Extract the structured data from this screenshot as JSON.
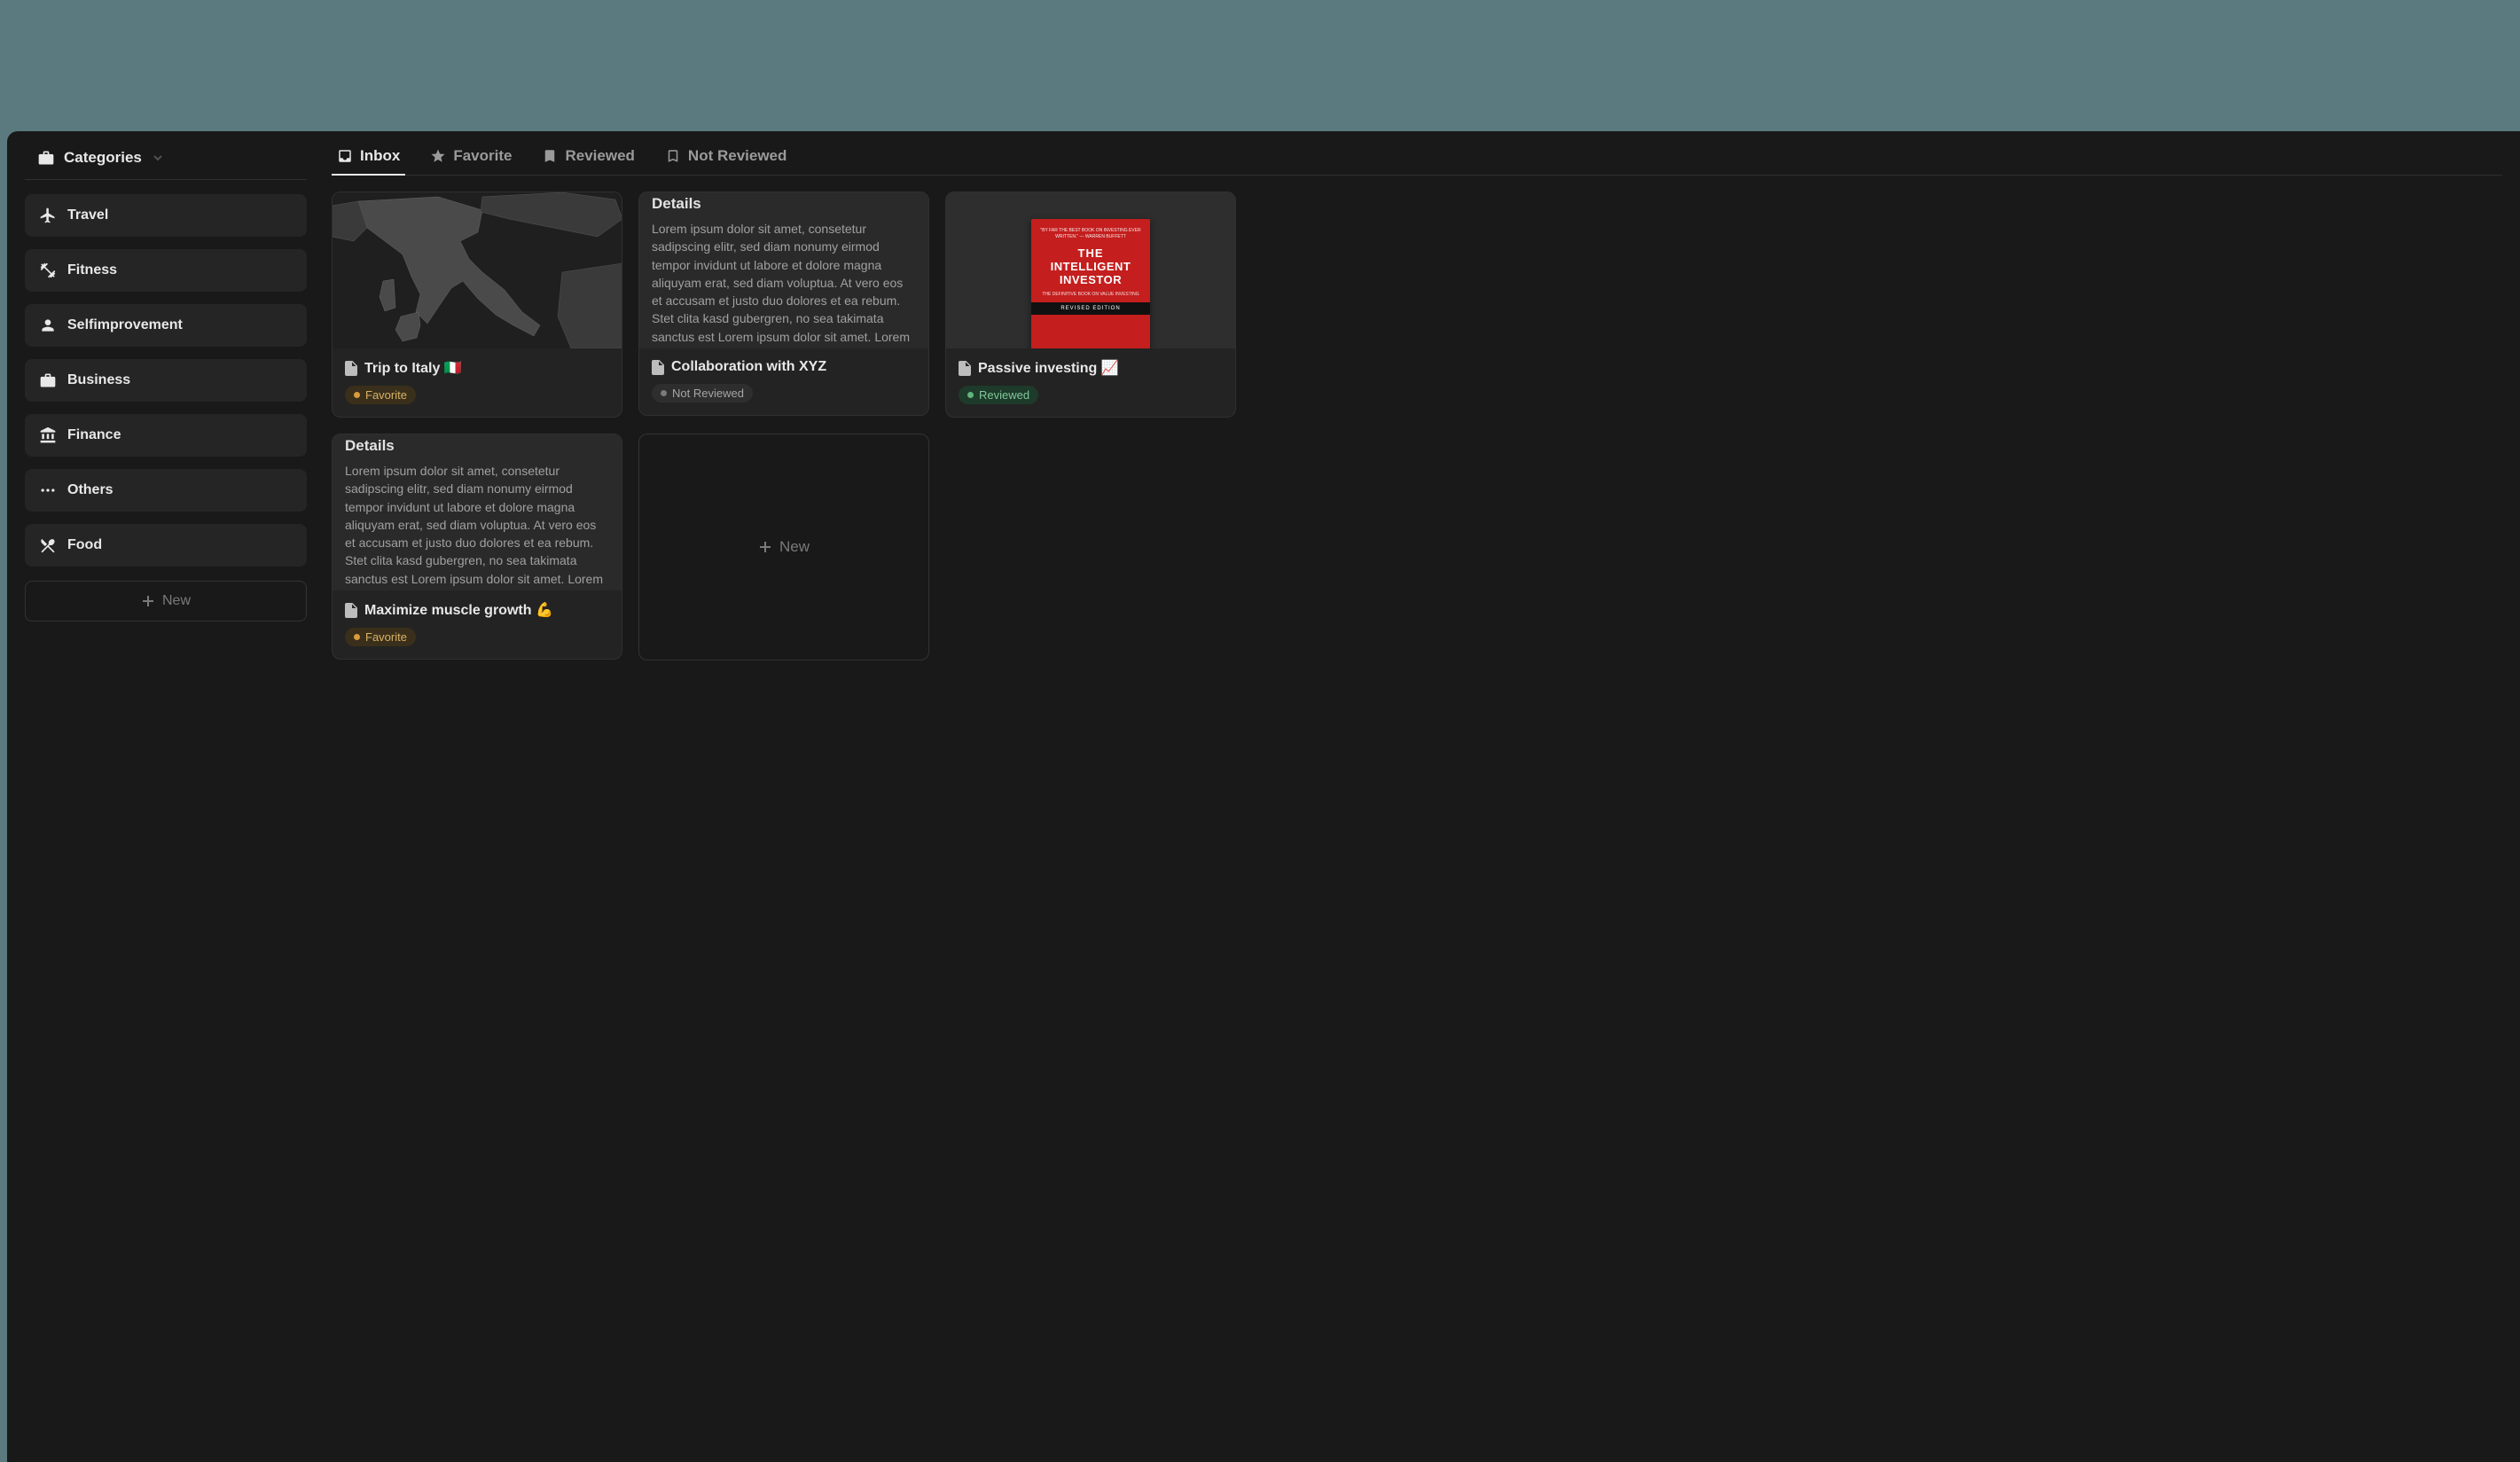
{
  "sidebar": {
    "header": "Categories",
    "items": [
      {
        "label": "Travel"
      },
      {
        "label": "Fitness"
      },
      {
        "label": "Selfimprovement"
      },
      {
        "label": "Business"
      },
      {
        "label": "Finance"
      },
      {
        "label": "Others"
      },
      {
        "label": "Food"
      }
    ],
    "new_label": "New"
  },
  "tabs": [
    {
      "label": "Inbox"
    },
    {
      "label": "Favorite"
    },
    {
      "label": "Reviewed"
    },
    {
      "label": "Not Reviewed"
    }
  ],
  "cards": [
    {
      "title": "Trip to Italy 🇮🇹",
      "badge_label": "Favorite"
    },
    {
      "details_heading": "Details",
      "details_body": "Lorem ipsum dolor sit amet, consetetur sadipscing elitr, sed diam nonumy eirmod tempor invidunt ut labore et dolore magna aliquyam erat, sed diam voluptua. At vero eos et accusam et justo duo dolores et ea rebum. Stet clita kasd gubergren, no sea takimata sanctus est Lorem ipsum dolor sit amet. Lorem",
      "title": "Collaboration with XYZ",
      "badge_label": "Not Reviewed"
    },
    {
      "book_tagline": "\"BY FAR THE BEST BOOK ON INVESTING EVER WRITTEN.\" — WARREN BUFFETT",
      "book_title_the": "THE",
      "book_title_main1": "INTELLIGENT",
      "book_title_main2": "INVESTOR",
      "book_sub": "THE DEFINITIVE BOOK ON VALUE INVESTING",
      "book_bar": "REVISED EDITION",
      "title": "Passive investing 📈",
      "badge_label": "Reviewed"
    },
    {
      "details_heading": "Details",
      "details_body": "Lorem ipsum dolor sit amet, consetetur sadipscing elitr, sed diam nonumy eirmod tempor invidunt ut labore et dolore magna aliquyam erat, sed diam voluptua. At vero eos et accusam et justo duo dolores et ea rebum. Stet clita kasd gubergren, no sea takimata sanctus est Lorem ipsum dolor sit amet. Lorem",
      "title": "Maximize muscle growth 💪",
      "badge_label": "Favorite"
    }
  ],
  "new_card_label": "New"
}
